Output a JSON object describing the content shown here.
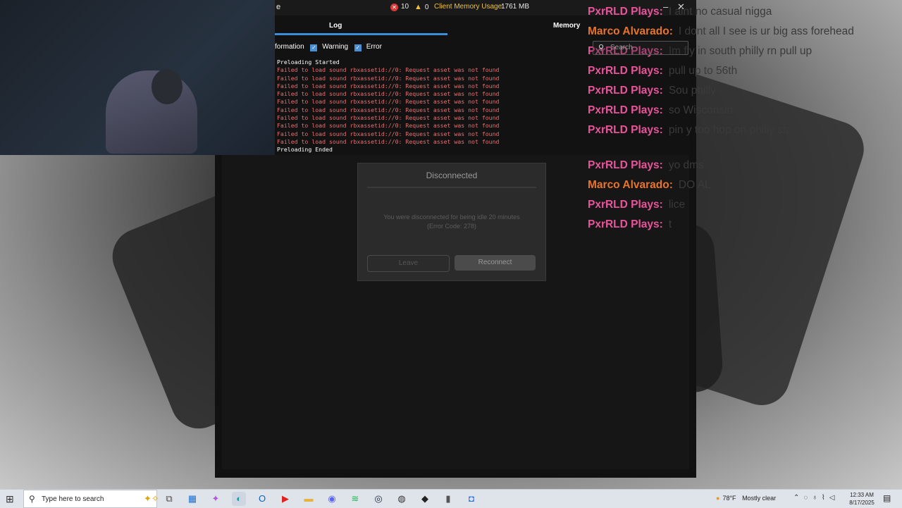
{
  "console": {
    "title_fragment": "e",
    "error_count": "10",
    "warning_count": "0",
    "memory_label": "Client Memory Usage:",
    "memory_value": "1761 MB",
    "tabs": [
      {
        "label": "Log"
      },
      {
        "label": "Memory"
      }
    ],
    "filters": [
      {
        "label": "formation"
      },
      {
        "label": "Warning"
      },
      {
        "label": "Error"
      }
    ],
    "log": [
      {
        "text": "Preloading Started",
        "level": "info"
      },
      {
        "text": "Failed to load sound rbxassetid://0: Request asset was not found",
        "level": "error"
      },
      {
        "text": "Failed to load sound rbxassetid://0: Request asset was not found",
        "level": "error"
      },
      {
        "text": "Failed to load sound rbxassetid://0: Request asset was not found",
        "level": "error"
      },
      {
        "text": "Failed to load sound rbxassetid://0: Request asset was not found",
        "level": "error"
      },
      {
        "text": "Failed to load sound rbxassetid://0: Request asset was not found",
        "level": "error"
      },
      {
        "text": "Failed to load sound rbxassetid://0: Request asset was not found",
        "level": "error"
      },
      {
        "text": "Failed to load sound rbxassetid://0: Request asset was not found",
        "level": "error"
      },
      {
        "text": "Failed to load sound rbxassetid://0: Request asset was not found",
        "level": "error"
      },
      {
        "text": "Failed to load sound rbxassetid://0: Request asset was not found",
        "level": "error"
      },
      {
        "text": "Failed to load sound rbxassetid://0: Request asset was not found",
        "level": "error"
      },
      {
        "text": "Preloading Ended",
        "level": "info"
      }
    ]
  },
  "dialog": {
    "title": "Disconnected",
    "message": "You were disconnected for being idle 20 minutes",
    "error_code": "(Error Code: 278)",
    "leave_label": "Leave",
    "reconnect_label": "Reconnect"
  },
  "chat": {
    "search_placeholder": "Search",
    "messages": [
      {
        "author": "PxrRLD Plays:",
        "text": "I aint no casual nigga",
        "color": "#e8549a"
      },
      {
        "author": "Marco Alvarado:",
        "text": "I dont all I see is ur big ass forehead",
        "color": "#e8742c"
      },
      {
        "author": "PxrRLD Plays:",
        "text": "Im fly in south philly rn pull up",
        "color": "#e8549a"
      },
      {
        "author": "PxrRLD Plays:",
        "text": "pull up to 56th",
        "color": "#e8549a"
      },
      {
        "author": "PxrRLD Plays:",
        "text": "Sou philly",
        "color": "#e8549a"
      },
      {
        "author": "PxrRLD Plays:",
        "text": "so Wisconsin",
        "color": "#e8549a"
      },
      {
        "author": "PxrRLD  Plays:",
        "text": "pin y too hop on philly str",
        "color": "#e8549a"
      },
      {
        "author": "PxrRLD Plays:",
        "text": "yo dms",
        "color": "#e8549a"
      },
      {
        "author": "Marco Alvarado:",
        "text": "DO AL",
        "color": "#e8742c"
      },
      {
        "author": "PxrRLD Plays:",
        "text": "lice",
        "color": "#e8549a"
      },
      {
        "author": "PxrRLD Plays:",
        "text": "t",
        "color": "#e8549a"
      }
    ]
  },
  "taskbar": {
    "search_placeholder": "Type here to search",
    "apps": [
      {
        "name": "task-view-icon",
        "glyph": "⧉",
        "color": "#4a4a4a"
      },
      {
        "name": "store-icon",
        "glyph": "▦",
        "color": "#1f6fd1"
      },
      {
        "name": "copilot-icon",
        "glyph": "✦",
        "color": "#b05ad8"
      },
      {
        "name": "edge-icon",
        "glyph": "◐",
        "color": "#1aa0a4"
      },
      {
        "name": "outlook-icon",
        "glyph": "O",
        "color": "#0b64c0"
      },
      {
        "name": "youtube-icon",
        "glyph": "▶",
        "color": "#e02020"
      },
      {
        "name": "file-explorer-icon",
        "glyph": "▬",
        "color": "#e5b43a"
      },
      {
        "name": "discord-icon",
        "glyph": "◉",
        "color": "#5865f2"
      },
      {
        "name": "spotify-icon",
        "glyph": "≋",
        "color": "#1db954"
      },
      {
        "name": "steam-icon",
        "glyph": "◎",
        "color": "#1b2838"
      },
      {
        "name": "chrome-icon",
        "glyph": "◍",
        "color": "#333333"
      },
      {
        "name": "roblox-studio-icon",
        "glyph": "◆",
        "color": "#222222"
      },
      {
        "name": "mouse-app-icon",
        "glyph": "▮",
        "color": "#555555"
      },
      {
        "name": "roblox-icon",
        "glyph": "◘",
        "color": "#2c6fe0"
      }
    ],
    "weather_temp": "78°F",
    "weather_text": "Mostly clear",
    "time": "12:33 AM",
    "date": "8/17/2025"
  }
}
